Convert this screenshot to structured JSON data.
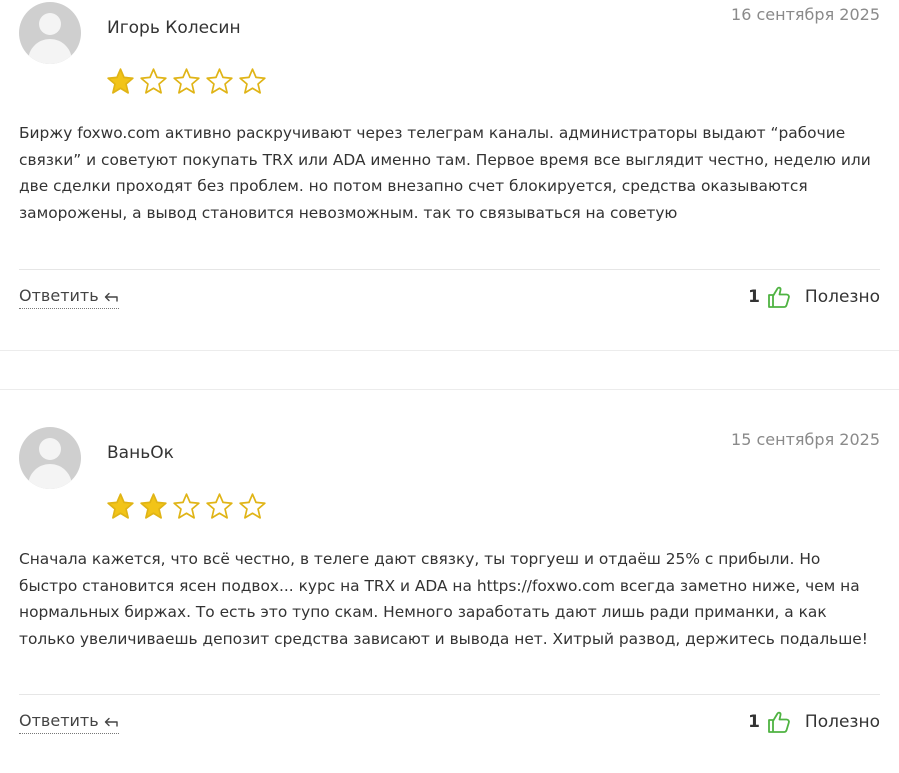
{
  "reviews": [
    {
      "author": "Игорь Колесин",
      "date": "16 сентября 2025",
      "rating": 1,
      "max_rating": 5,
      "text": "Биржу foxwo.com активно раскручивают через телеграм каналы. администраторы выдают “рабочие связки” и советуют покупать TRX или ADA именно там. Первое время все выглядит честно, неделю или две сделки проходят без проблем. но потом внезапно счет блокируется, средства оказываются заморожены, а вывод становится невозможным. так то связываться на советую",
      "reply_label": "Ответить",
      "useful_count": "1",
      "useful_label": "Полезно"
    },
    {
      "author": "ВаньОк",
      "date": "15 сентября 2025",
      "rating": 2,
      "max_rating": 5,
      "text": "Сначала кажется, что всё честно, в телеге дают связку, ты торгуеш и отдаёш 25% с прибыли. Но быстро становится ясен подвох... курс на TRX и ADA на https://foxwo.com всегда заметно ниже, чем на нормальных биржах. То есть это тупо скам. Немного заработать дают лишь ради приманки, а как только увеличиваешь депозит средства зависают и вывода нет. Хитрый развод, держитесь подальше!",
      "reply_label": "Ответить",
      "useful_count": "1",
      "useful_label": "Полезно"
    }
  ],
  "colors": {
    "star_filled": "#f2c418",
    "star_outline": "#e0b416",
    "thumb": "#4fb342",
    "date": "#8a8a8a",
    "separator": "#e6e6e6"
  },
  "icons": {
    "reply": "reply-arrow-icon",
    "useful": "thumbs-up-icon",
    "avatar": "user-avatar-icon"
  }
}
